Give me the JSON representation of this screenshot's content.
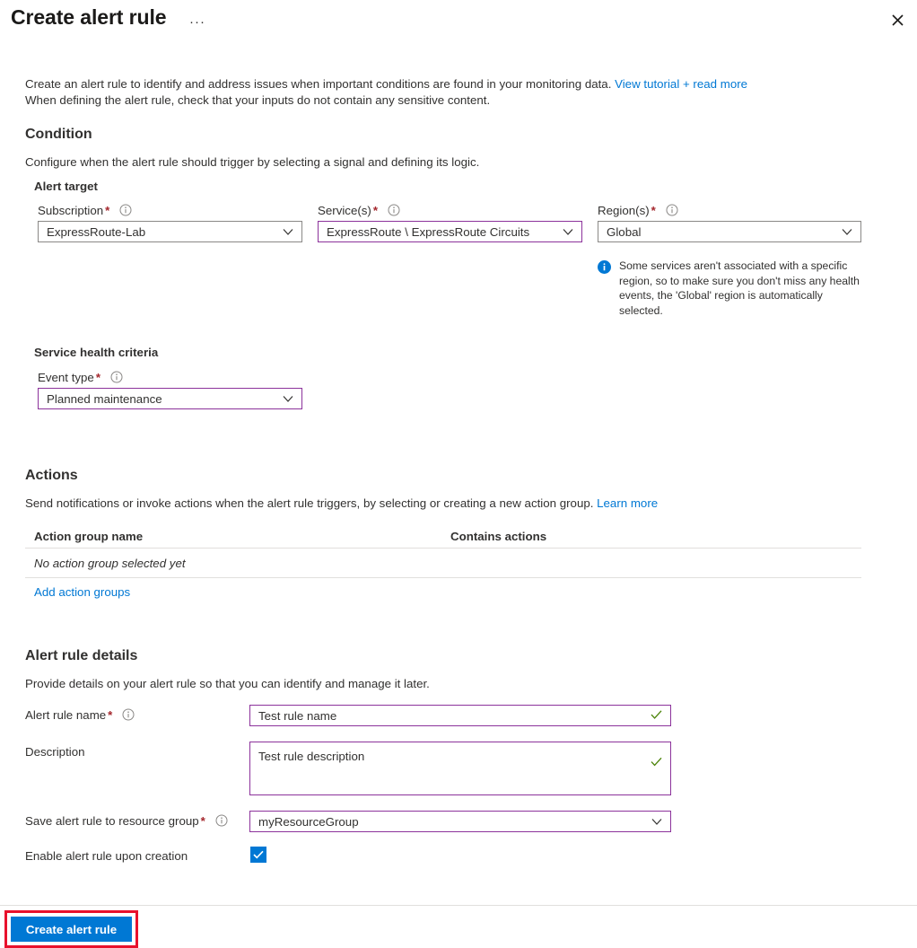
{
  "header": {
    "title": "Create alert rule",
    "more_menu": "···",
    "close_label": "Close"
  },
  "intro": {
    "line1_a": "Create an alert rule to identify and address issues when important conditions are found in your monitoring data. ",
    "line1_link": "View tutorial + read more",
    "line2": "When defining the alert rule, check that your inputs do not contain any sensitive content."
  },
  "condition": {
    "heading": "Condition",
    "description": "Configure when the alert rule should trigger by selecting a signal and defining its logic.",
    "alert_target_heading": "Alert target",
    "subscription": {
      "label": "Subscription",
      "required": "*",
      "value": "ExpressRoute-Lab"
    },
    "services": {
      "label": "Service(s)",
      "required": "*",
      "value": "ExpressRoute \\ ExpressRoute Circuits"
    },
    "regions": {
      "label": "Region(s)",
      "required": "*",
      "value": "Global"
    },
    "region_info": "Some services aren't associated with a specific region, so to make sure you don't miss any health events, the 'Global' region is automatically selected.",
    "service_health_heading": "Service health criteria",
    "event_type": {
      "label": "Event type",
      "required": "*",
      "value": "Planned maintenance"
    }
  },
  "actions": {
    "heading": "Actions",
    "description_a": "Send notifications or invoke actions when the alert rule triggers, by selecting or creating a new action group. ",
    "description_link": "Learn more",
    "columns": [
      "Action group name",
      "Contains actions"
    ],
    "empty_row": "No action group selected yet",
    "add_link": "Add action groups"
  },
  "alert_rule_details": {
    "heading": "Alert rule details",
    "description": "Provide details on your alert rule so that you can identify and manage it later.",
    "rule_name": {
      "label": "Alert rule name",
      "required": "*",
      "value": "Test rule name"
    },
    "rule_description": {
      "label": "Description",
      "value": "Test rule description"
    },
    "resource_group": {
      "label": "Save alert rule to resource group",
      "required": "*",
      "value": "myResourceGroup"
    },
    "enable_on_creation": {
      "label": "Enable alert rule upon creation",
      "checked": true
    }
  },
  "footer": {
    "create_button": "Create alert rule"
  },
  "colors": {
    "accent_blue": "#0078d4",
    "focus_purple": "#8c329b",
    "required_red": "#a4262c",
    "valid_green": "#498205",
    "highlight_red": "#e8112d"
  }
}
